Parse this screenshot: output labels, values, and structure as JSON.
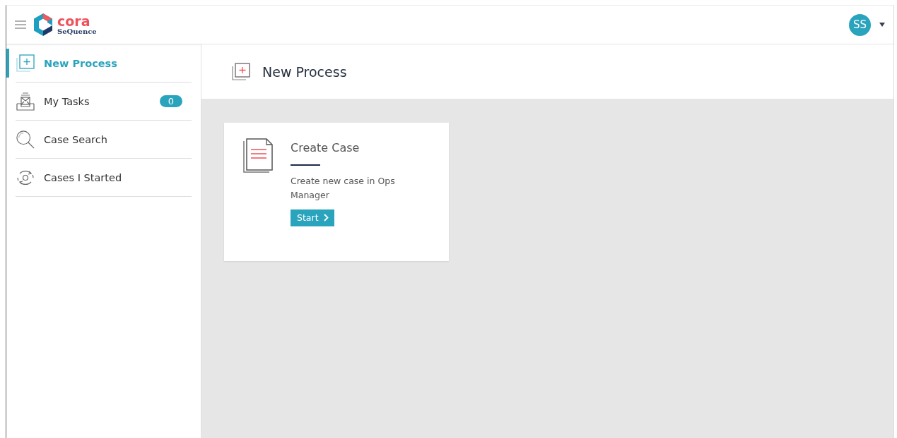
{
  "header": {
    "logo": {
      "word": "cora",
      "subword": "SeQuence"
    },
    "user": {
      "initials": "SS"
    }
  },
  "sidebar": {
    "items": [
      {
        "kind": "new",
        "label": "New Process",
        "selected": true
      },
      {
        "kind": "tasks",
        "label": "My Tasks",
        "selected": false,
        "badge": "0"
      },
      {
        "kind": "search",
        "label": "Case Search",
        "selected": false
      },
      {
        "kind": "started",
        "label": "Cases I Started",
        "selected": false
      }
    ]
  },
  "page": {
    "title": "New Process"
  },
  "cards": [
    {
      "title": "Create Case",
      "description": "Create new case in Ops Manager",
      "button": "Start"
    }
  ]
}
